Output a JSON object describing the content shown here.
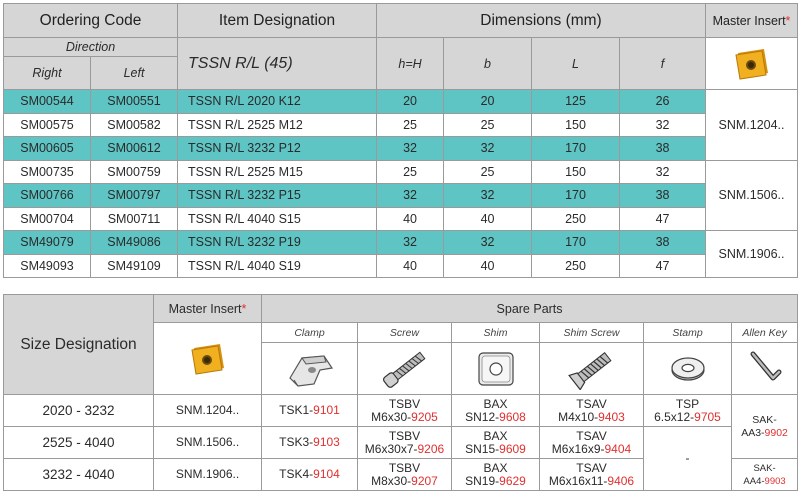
{
  "table1": {
    "headers": {
      "ordering_code": "Ordering Code",
      "item_designation": "Item Designation",
      "dimensions": "Dimensions (mm)",
      "master_insert": "Master Insert",
      "master_insert_mark": "*",
      "direction": "Direction",
      "right": "Right",
      "left": "Left",
      "designation_family": "TSSN R/L (45)",
      "h": "h=H",
      "b": "b",
      "L": "L",
      "f": "f"
    },
    "rows": [
      {
        "right": "SM00544",
        "left": "SM00551",
        "item": "TSSN R/L 2020 K12",
        "h": "20",
        "b": "20",
        "L": "125",
        "f": "26"
      },
      {
        "right": "SM00575",
        "left": "SM00582",
        "item": "TSSN R/L 2525 M12",
        "h": "25",
        "b": "25",
        "L": "150",
        "f": "32"
      },
      {
        "right": "SM00605",
        "left": "SM00612",
        "item": "TSSN R/L 3232 P12",
        "h": "32",
        "b": "32",
        "L": "170",
        "f": "38"
      },
      {
        "right": "SM00735",
        "left": "SM00759",
        "item": "TSSN R/L 2525 M15",
        "h": "25",
        "b": "25",
        "L": "150",
        "f": "32"
      },
      {
        "right": "SM00766",
        "left": "SM00797",
        "item": "TSSN R/L 3232 P15",
        "h": "32",
        "b": "32",
        "L": "170",
        "f": "38"
      },
      {
        "right": "SM00704",
        "left": "SM00711",
        "item": "TSSN R/L 4040 S15",
        "h": "40",
        "b": "40",
        "L": "250",
        "f": "47"
      },
      {
        "right": "SM49079",
        "left": "SM49086",
        "item": "TSSN R/L 3232 P19",
        "h": "32",
        "b": "32",
        "L": "170",
        "f": "38"
      },
      {
        "right": "SM49093",
        "left": "SM49109",
        "item": "TSSN R/L 4040 S19",
        "h": "40",
        "b": "40",
        "L": "250",
        "f": "47"
      }
    ],
    "master_groups": [
      "SNM.1204..",
      "SNM.1506..",
      "SNM.1906.."
    ]
  },
  "table2": {
    "headers": {
      "size_designation": "Size Designation",
      "master_insert": "Master Insert",
      "master_insert_mark": "*",
      "spare_parts": "Spare Parts",
      "clamp": "Clamp",
      "screw": "Screw",
      "shim": "Shim",
      "shim_screw": "Shim Screw",
      "stamp": "Stamp",
      "allen_key": "Allen Key"
    },
    "rows": [
      {
        "size": "2020 - 3232",
        "master": "SNM.1204..",
        "clamp_a": "TSK1-",
        "clamp_b": "9101",
        "screw_l1": "TSBV",
        "screw_a": "M6x30-",
        "screw_b": "9205",
        "shim_l1": "BAX",
        "shim_a": "SN12-",
        "shim_b": "9608",
        "shimscrew_l1": "TSAV",
        "shimscrew_a": "M4x10-",
        "shimscrew_b": "9403",
        "stamp_l1": "TSP",
        "stamp_a": "6.5x12-",
        "stamp_b": "9705"
      },
      {
        "size": "2525 - 4040",
        "master": "SNM.1506..",
        "clamp_a": "TSK3-",
        "clamp_b": "9103",
        "screw_l1": "TSBV",
        "screw_a": "M6x30x7-",
        "screw_b": "9206",
        "shim_l1": "BAX",
        "shim_a": "SN15-",
        "shim_b": "9609",
        "shimscrew_l1": "TSAV",
        "shimscrew_a": "M6x16x9-",
        "shimscrew_b": "9404"
      },
      {
        "size": "3232 - 4040",
        "master": "SNM.1906..",
        "clamp_a": "TSK4-",
        "clamp_b": "9104",
        "screw_l1": "TSBV",
        "screw_a": "M8x30-",
        "screw_b": "9207",
        "shim_l1": "BAX",
        "shim_a": "SN19-",
        "shim_b": "9629",
        "shimscrew_l1": "TSAV",
        "shimscrew_a": "M6x16x11-",
        "shimscrew_b": "9406"
      }
    ],
    "stamp_dash": "-",
    "allen_1_a": "SAK-",
    "allen_1_b": "AA3-",
    "allen_1_c": "9902",
    "allen_2_a": "SAK-",
    "allen_2_b": "AA4-",
    "allen_2_c": "9903"
  },
  "colors": {
    "teal_row": "#5ec4c4",
    "header_gray": "#d6d6d6",
    "code_red": "#e03030",
    "insert_gold": "#e8a417"
  }
}
